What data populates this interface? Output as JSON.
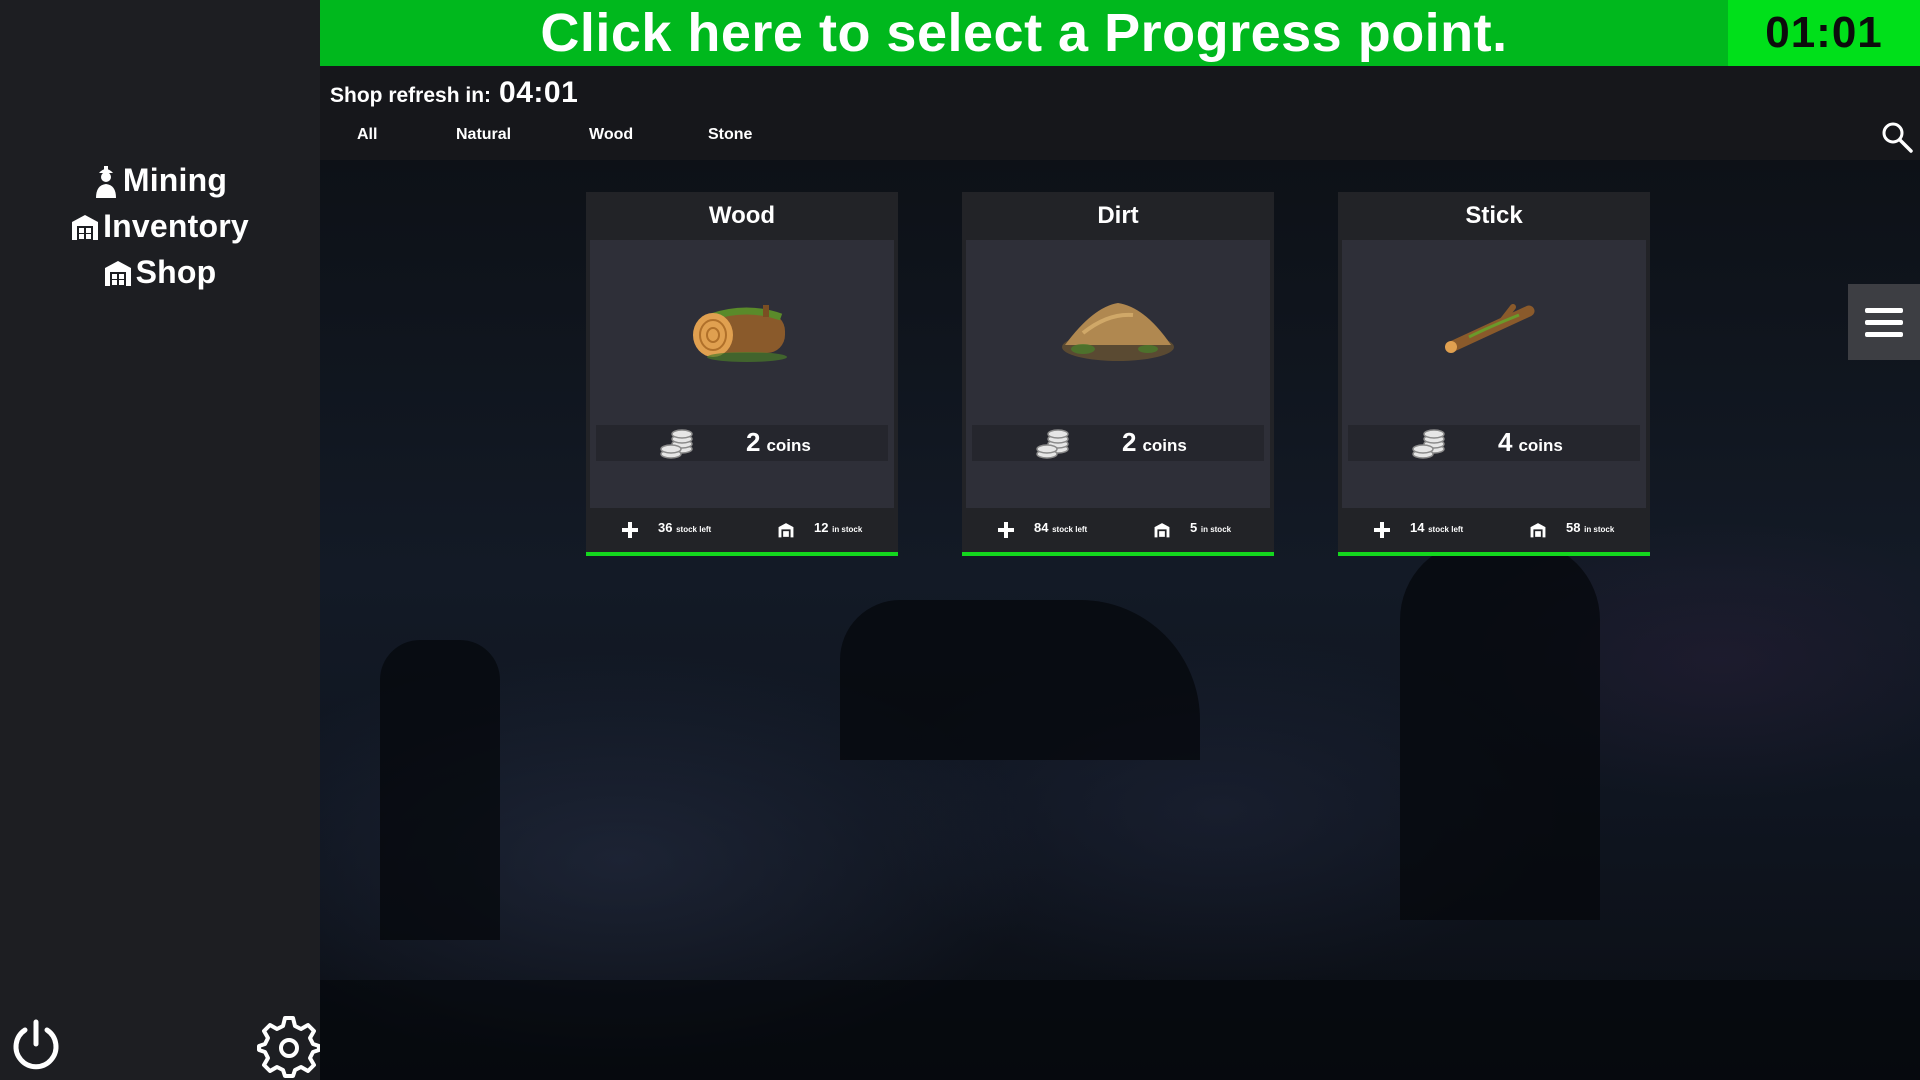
{
  "banner": {
    "text": "Click here to select a Progress point.",
    "timer": "01:01"
  },
  "sidebar": {
    "items": [
      {
        "label": "Mining",
        "icon": "miner-icon"
      },
      {
        "label": "Inventory",
        "icon": "warehouse-icon"
      },
      {
        "label": "Shop",
        "icon": "shop-icon"
      }
    ],
    "power_icon": "power-icon",
    "settings_icon": "gear-icon"
  },
  "header": {
    "refresh_label": "Shop refresh in:",
    "refresh_time": "04:01",
    "tabs": [
      "All",
      "Natural",
      "Wood",
      "Stone"
    ],
    "search_icon": "search-icon"
  },
  "cards": [
    {
      "title": "Wood",
      "price": "2",
      "price_unit": "coins",
      "stock_left": "36",
      "stock_left_label": "stock left",
      "in_stock": "12",
      "in_stock_label": "in stock"
    },
    {
      "title": "Dirt",
      "price": "2",
      "price_unit": "coins",
      "stock_left": "84",
      "stock_left_label": "stock left",
      "in_stock": "5",
      "in_stock_label": "in stock"
    },
    {
      "title": "Stick",
      "price": "4",
      "price_unit": "coins",
      "stock_left": "14",
      "stock_left_label": "stock left",
      "in_stock": "58",
      "in_stock_label": "in stock"
    }
  ],
  "colors": {
    "banner": "#00b81d",
    "timer": "#00e01a",
    "card_accent": "#14d71e",
    "sidebar": "#1d1e22"
  },
  "menu_icon": "hamburger-icon"
}
